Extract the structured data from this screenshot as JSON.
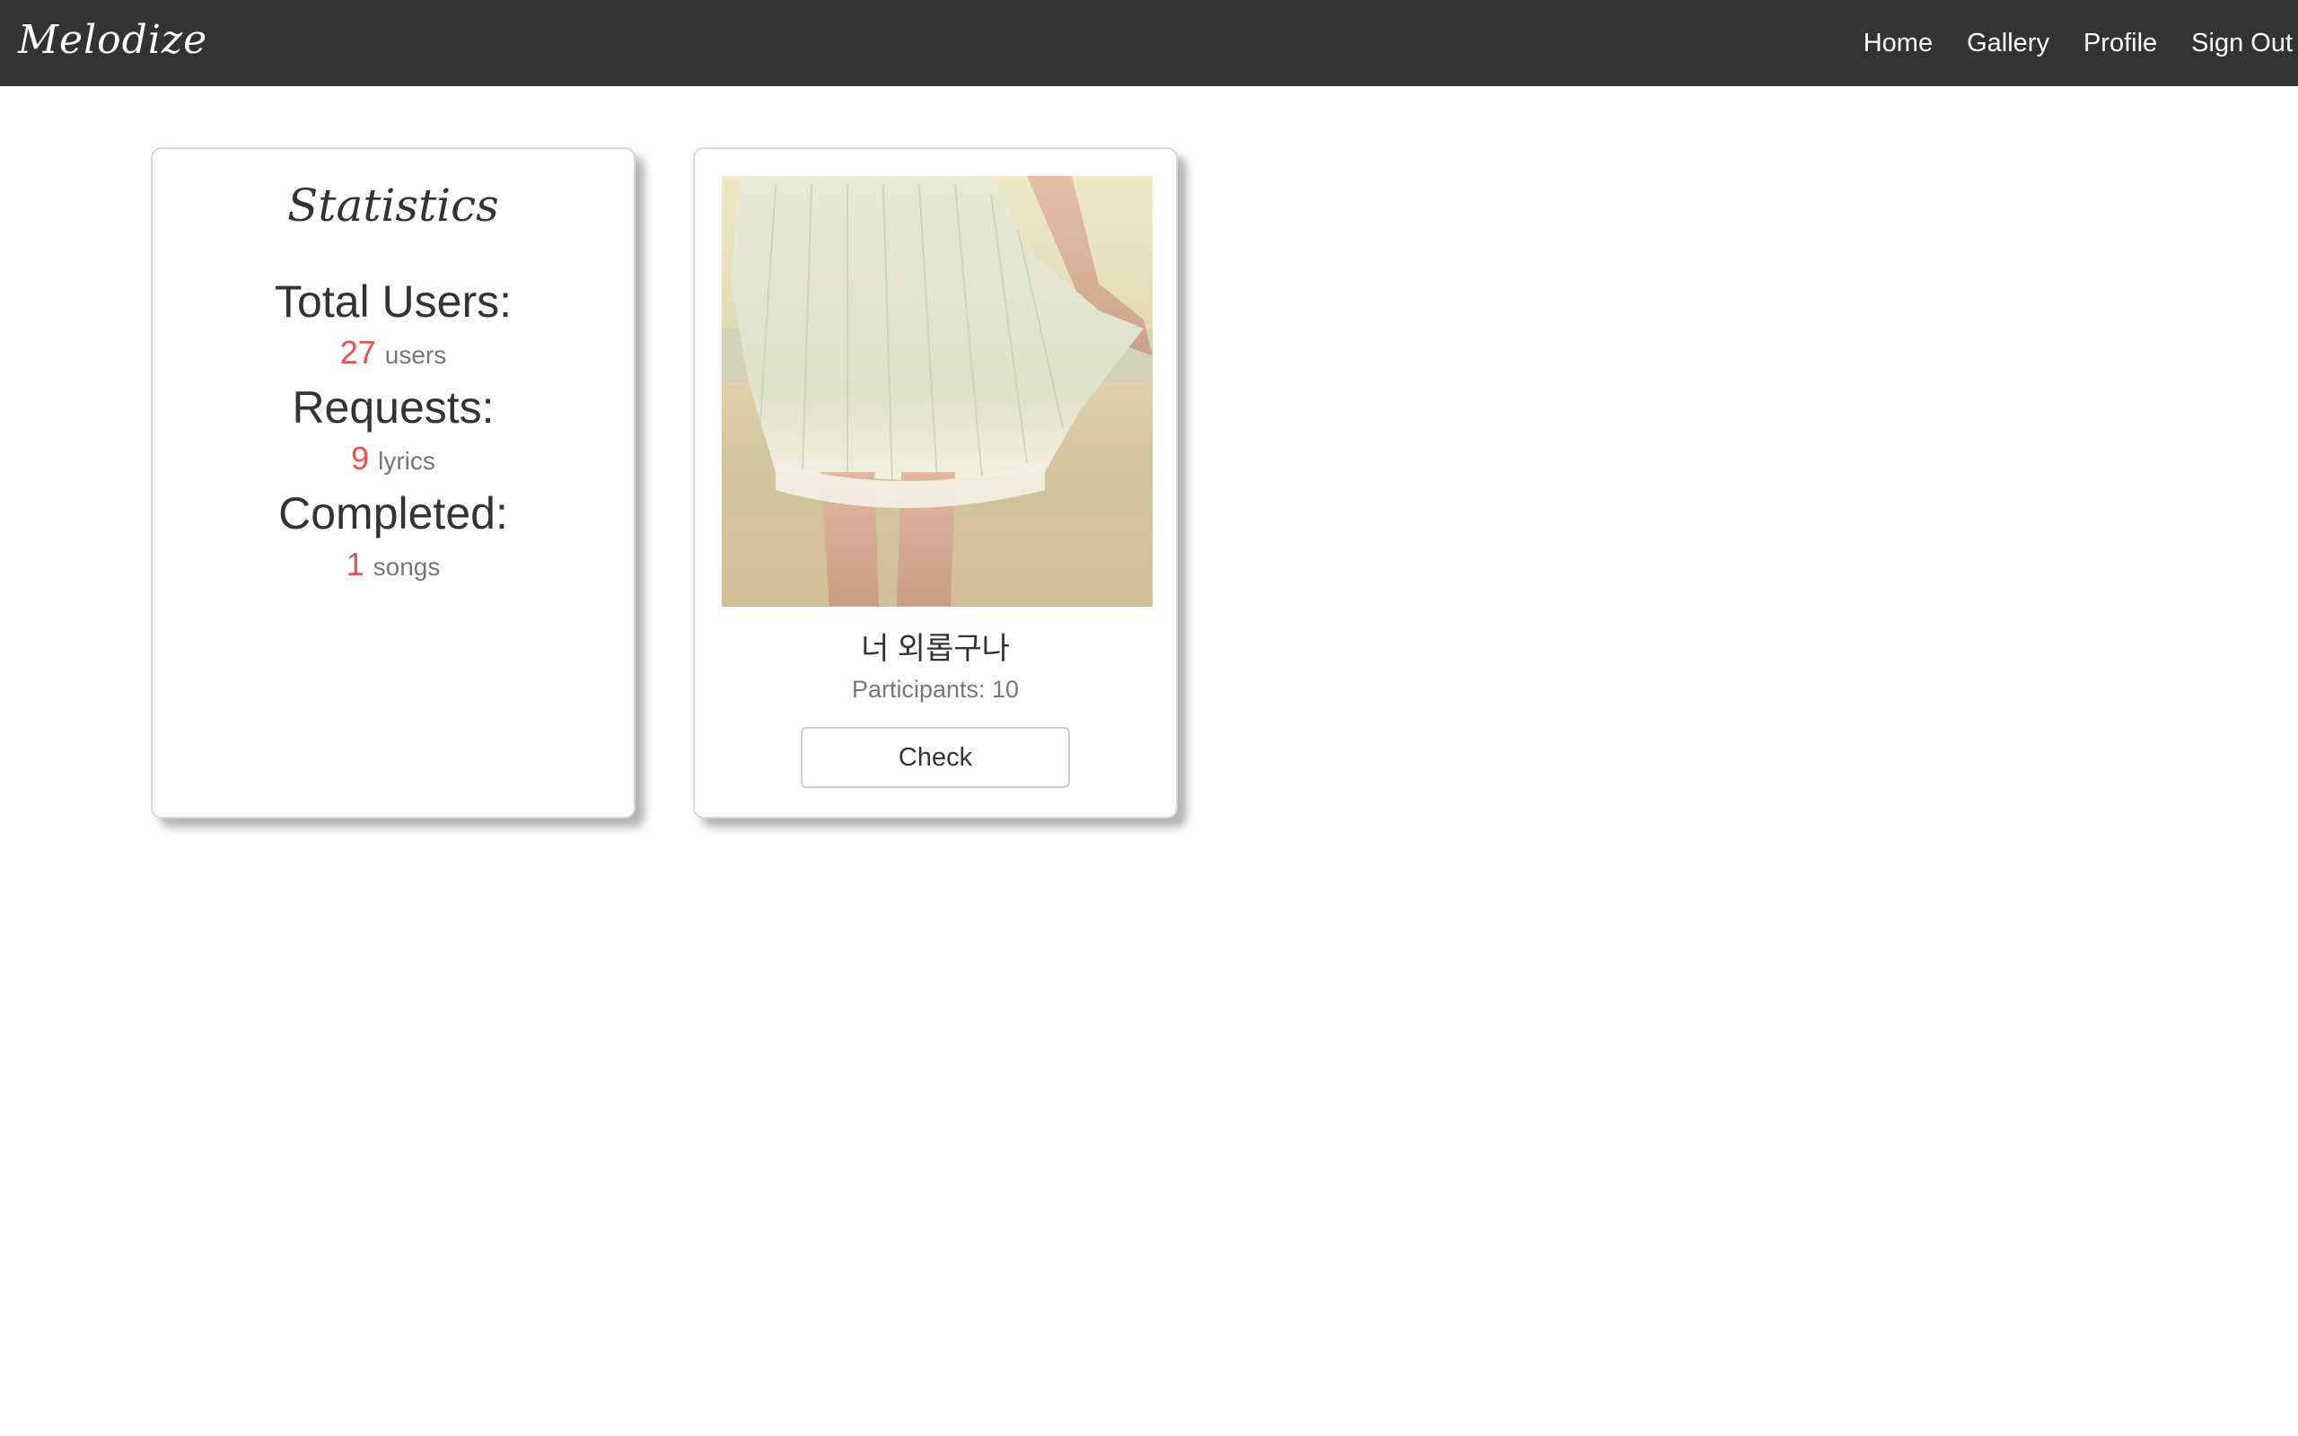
{
  "navbar": {
    "brand": "Melodize",
    "links": [
      "Home",
      "Gallery",
      "Profile",
      "Sign Out"
    ]
  },
  "statistics": {
    "title": "Statistics",
    "items": [
      {
        "label": "Total Users:",
        "value": "27",
        "unit": "users"
      },
      {
        "label": "Requests:",
        "value": "9",
        "unit": "lyrics"
      },
      {
        "label": "Completed:",
        "value": "1",
        "unit": "songs"
      }
    ]
  },
  "song_card": {
    "title": "너 외롭구나",
    "participants": "Participants: 10",
    "button_label": "Check"
  },
  "colors": {
    "navbar_bg": "#333333",
    "stat_value": "#e8534f",
    "muted_text": "#777777"
  }
}
